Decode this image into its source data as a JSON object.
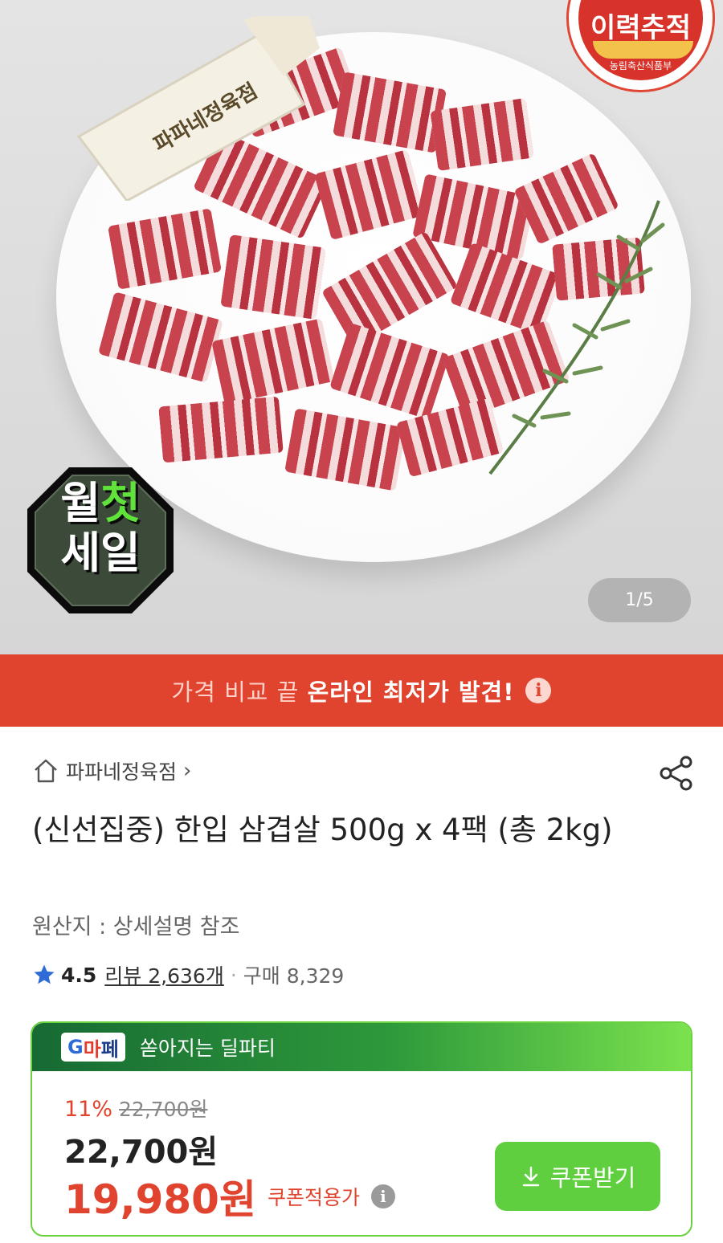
{
  "hero": {
    "brand_badge": "이력추적",
    "brand_badge_sub": "농림축산식품부",
    "knife_text": "파파네정육점",
    "sale_line1_a": "월",
    "sale_line1_b": "첫",
    "sale_line2": "세일",
    "counter": "1/5"
  },
  "promo": {
    "text_prefix": "가격 비교 끝",
    "text_bold": "온라인 최저가 발견!",
    "info_glyph": "i"
  },
  "product": {
    "store_name": "파파네정육점",
    "store_chevron": "›",
    "title": "(신선집중) 한입 삼겹살 500g x 4팩 (총 2kg)",
    "origin": "원산지 : 상세설명 참조",
    "rating_score": "4.5",
    "review_label": "리뷰 2,636개",
    "separator": "·",
    "purchase_label": "구매 8,329"
  },
  "deal_card": {
    "logo_g": "G",
    "logo_r": "마",
    "logo_b": "페",
    "header_text": "쏟아지는 딜파티",
    "discount_pct": "11%",
    "original_price": "22,700원",
    "price": "22,700원",
    "final_price": "19,980원",
    "final_label": "쿠폰적용가",
    "info_glyph": "i",
    "coupon_button": "쿠폰받기"
  },
  "colors": {
    "accent_red": "#e0432e",
    "deal_green": "#5fcf3f"
  }
}
